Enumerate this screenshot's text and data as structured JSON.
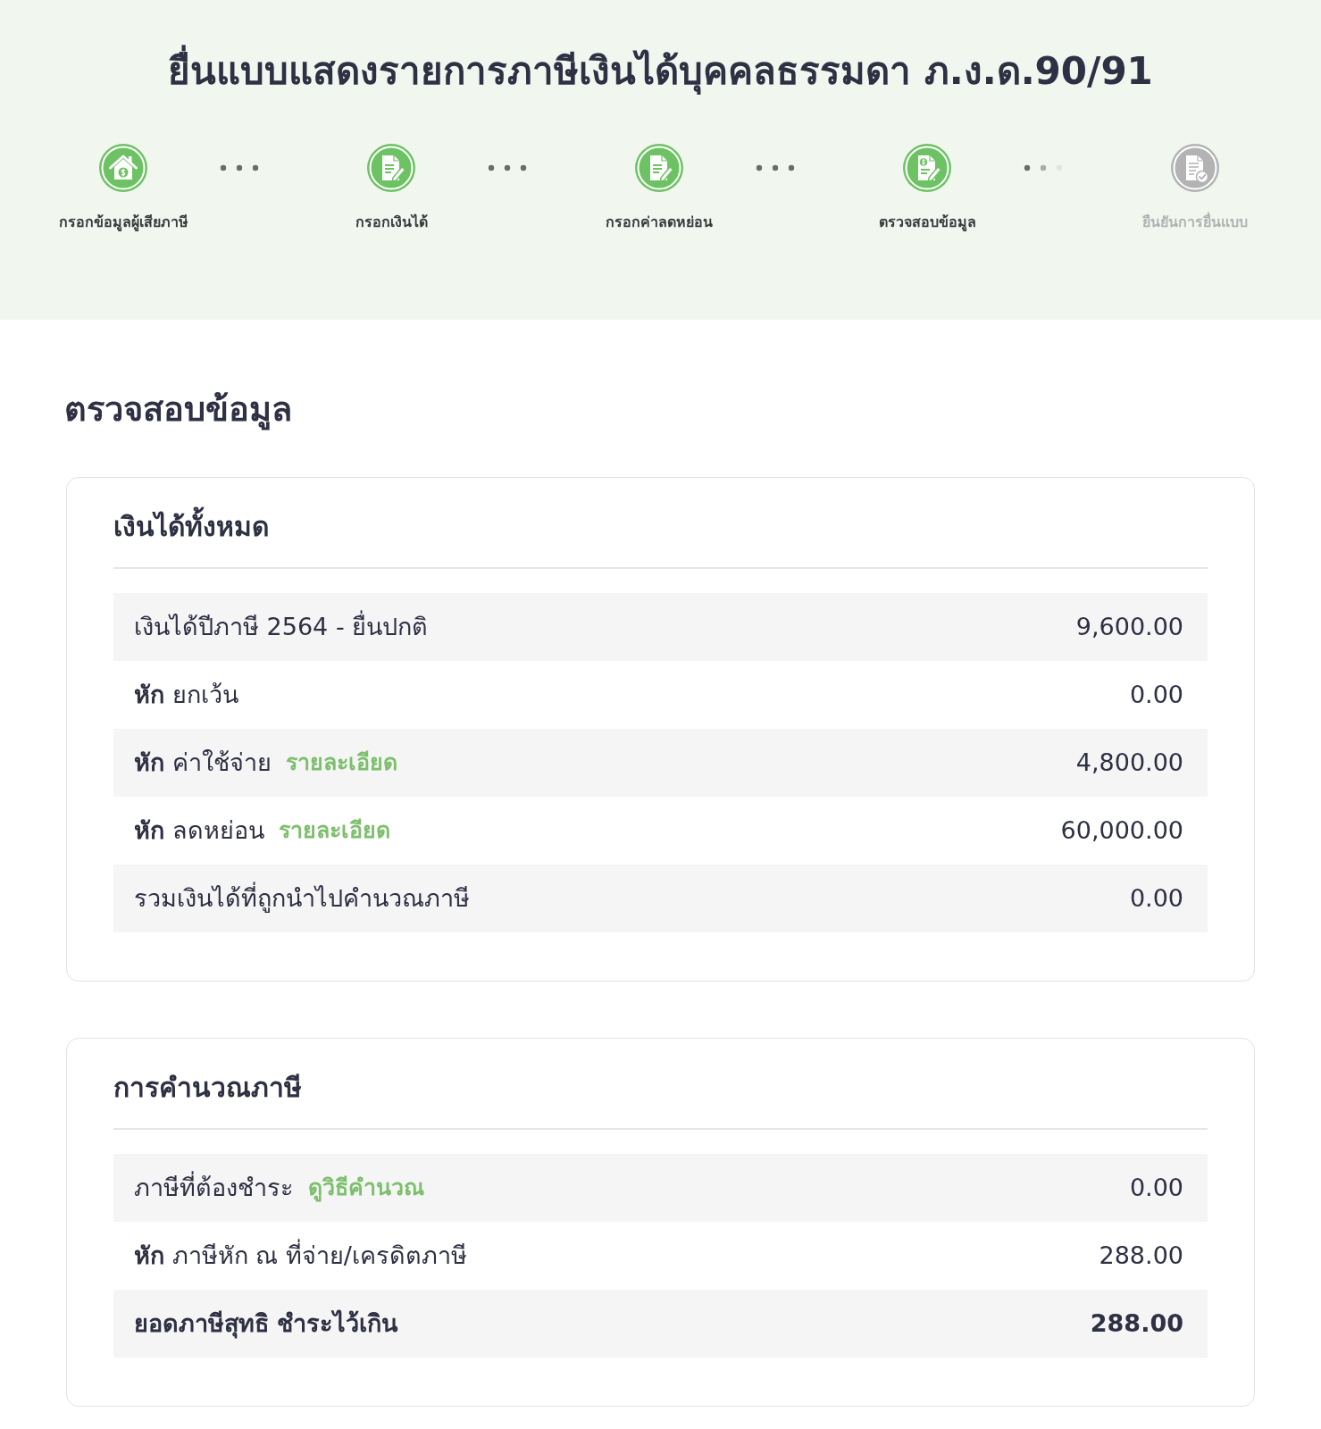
{
  "title": "ยื่นแบบแสดงรายการภาษีเงินได้บุคคลธรรมดา ภ.ง.ด.90/91",
  "steps": [
    {
      "label": "กรอกข้อมูลผู้เสียภาษี",
      "done": true
    },
    {
      "label": "กรอกเงินได้",
      "done": true
    },
    {
      "label": "กรอกค่าลดหย่อน",
      "done": true
    },
    {
      "label": "ตรวจสอบข้อมูล",
      "done": true
    },
    {
      "label": "ยืนยันการยื่นแบบ",
      "done": false
    }
  ],
  "heading": "ตรวจสอบข้อมูล",
  "sections": [
    {
      "title": "เงินได้ทั้งหมด",
      "rows": [
        {
          "label": "เงินได้ปีภาษี 2564 - ยื่นปกติ",
          "value": "9,600.00",
          "total": false
        },
        {
          "label": "**หัก** ยกเว้น",
          "value": "0.00",
          "total": false
        },
        {
          "label": "**หัก** ค่าใช้จ่าย",
          "link": "รายละเอียด",
          "value": "4,800.00",
          "total": false
        },
        {
          "label": "**หัก** ลดหย่อน",
          "link": "รายละเอียด",
          "value": "60,000.00",
          "total": false
        },
        {
          "label": "รวมเงินได้ที่ถูกนำไปคำนวณภาษี",
          "value": "0.00",
          "total": false
        }
      ]
    },
    {
      "title": "การคำนวณภาษี",
      "rows": [
        {
          "label": "ภาษีที่ต้องชำระ",
          "link": "ดูวิธีคำนวณ",
          "value": "0.00",
          "total": false
        },
        {
          "label": "**หัก** ภาษีหัก ณ ที่จ่าย/เครดิตภาษี",
          "value": "288.00",
          "total": false
        },
        {
          "label": "ยอดภาษีสุทธิ ชำระไว้เกิน",
          "value": "288.00",
          "total": true
        }
      ]
    }
  ]
}
